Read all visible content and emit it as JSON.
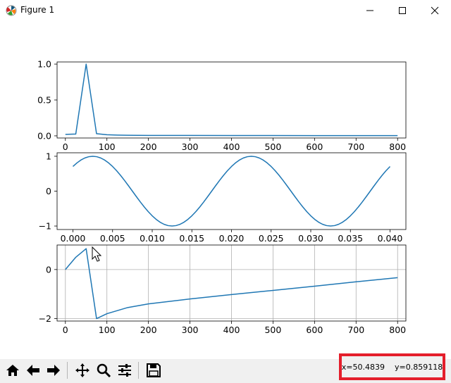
{
  "window": {
    "title": "Figure 1"
  },
  "status": {
    "x": "x=50.4839",
    "y": "y=0.859118"
  },
  "toolbar": {
    "buttons": [
      {
        "name": "home",
        "icon": "home-icon"
      },
      {
        "name": "back",
        "icon": "arrow-left-icon"
      },
      {
        "name": "forward",
        "icon": "arrow-right-icon"
      },
      {
        "name": "pan",
        "icon": "move-icon"
      },
      {
        "name": "zoom",
        "icon": "magnifier-icon"
      },
      {
        "name": "configure",
        "icon": "sliders-icon"
      },
      {
        "name": "save",
        "icon": "floppy-icon"
      }
    ]
  },
  "colors": {
    "line": "#1f77b4",
    "grid": "#b0b0b0",
    "highlight": "#e41e2b"
  },
  "chart_data": [
    {
      "type": "line",
      "xlim": [
        -20,
        820
      ],
      "ylim": [
        -0.03,
        1.03
      ],
      "xticks": [
        0,
        100,
        200,
        300,
        400,
        500,
        600,
        700,
        800
      ],
      "xtick_labels": [
        "0",
        "100",
        "200",
        "300",
        "400",
        "500",
        "600",
        "700",
        "800"
      ],
      "yticks": [
        0.0,
        0.5,
        1.0
      ],
      "ytick_labels": [
        "0.0",
        "0.5",
        "1.0"
      ],
      "grid": false,
      "x": [
        0,
        25,
        50,
        75,
        100,
        125,
        150,
        200,
        300,
        400,
        500,
        600,
        700,
        800
      ],
      "y": [
        0.02,
        0.025,
        1.0,
        0.03,
        0.015,
        0.01,
        0.008,
        0.006,
        0.005,
        0.004,
        0.004,
        0.003,
        0.003,
        0.003
      ]
    },
    {
      "type": "line",
      "xlim": [
        -0.002,
        0.042
      ],
      "ylim": [
        -1.1,
        1.1
      ],
      "xticks": [
        0,
        0.005,
        0.01,
        0.015,
        0.02,
        0.025,
        0.03,
        0.035,
        0.04
      ],
      "xtick_labels": [
        "0.000",
        "0.005",
        "0.010",
        "0.015",
        "0.020",
        "0.025",
        "0.030",
        "0.035",
        "0.040"
      ],
      "yticks": [
        -1,
        0,
        1
      ],
      "ytick_labels": [
        "−1",
        "0",
        "1"
      ],
      "grid": false,
      "function": {
        "kind": "sine",
        "frequency": 50,
        "phase": 0.785398,
        "x_start": 0,
        "x_end": 0.04,
        "points": 80
      }
    },
    {
      "type": "line",
      "xlim": [
        -20,
        820
      ],
      "ylim": [
        -2.1,
        1.0
      ],
      "xticks": [
        0,
        100,
        200,
        300,
        400,
        500,
        600,
        700,
        800
      ],
      "xtick_labels": [
        "0",
        "100",
        "200",
        "300",
        "400",
        "500",
        "600",
        "700",
        "800"
      ],
      "yticks": [
        -2,
        0
      ],
      "ytick_labels": [
        "−2",
        "0"
      ],
      "grid": true,
      "x": [
        0,
        25,
        50,
        75,
        100,
        150,
        200,
        300,
        400,
        500,
        600,
        700,
        800
      ],
      "y": [
        0.0,
        0.5,
        0.85,
        -2.0,
        -1.8,
        -1.55,
        -1.4,
        -1.2,
        -1.02,
        -0.85,
        -0.68,
        -0.5,
        -0.33
      ]
    }
  ]
}
